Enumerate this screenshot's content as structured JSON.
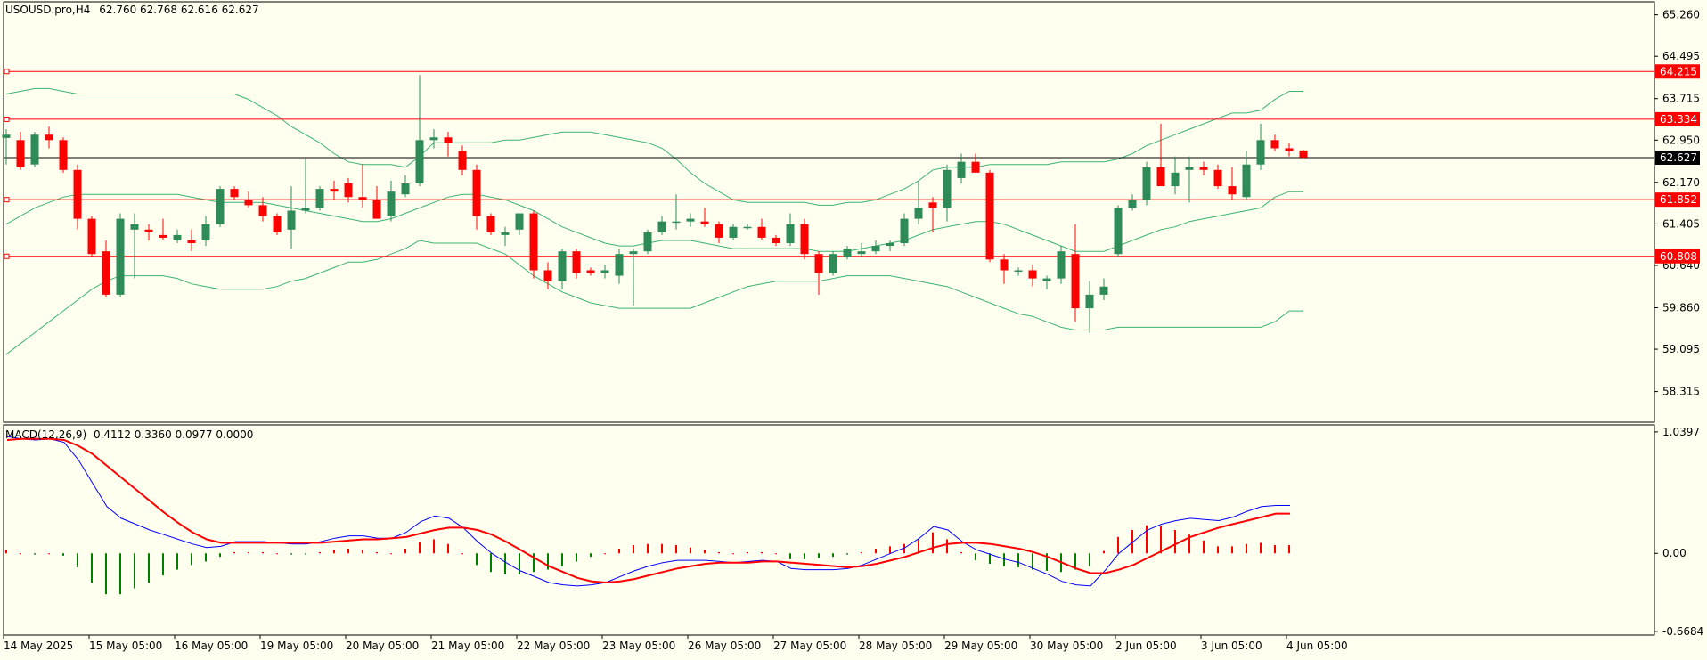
{
  "header": {
    "symbol": "USOUSD.pro,H4",
    "ohlc": "62.760 62.768 62.616 62.627"
  },
  "macd_header": {
    "title": "MACD(12,26,9)",
    "values": "0.4112 0.3360 0.0977 0.0000"
  },
  "colors": {
    "background": "#fffff0",
    "bull_candle": "#2e8b57",
    "bear_candle": "#ff0000",
    "bands": "#3cb371",
    "level_line": "#ff0000",
    "price_line": "#000000",
    "macd_line": "#0000ff",
    "signal_line": "#ff0000",
    "hist_positive": "#ff0000",
    "hist_negative": "#008000"
  },
  "chart_data": {
    "type": "candlestick",
    "symbol": "USOUSD.pro",
    "timeframe": "H4",
    "price_axis": {
      "ylim": [
        57.75,
        65.5
      ],
      "ticks": [
        "65.260",
        "64.495",
        "63.715",
        "62.950",
        "62.170",
        "61.405",
        "60.640",
        "59.860",
        "59.095",
        "58.315"
      ]
    },
    "time_axis": {
      "ticks": [
        {
          "label": "14 May 2025",
          "bar": 0
        },
        {
          "label": "15 May 05:00",
          "bar": 6
        },
        {
          "label": "16 May 05:00",
          "bar": 12
        },
        {
          "label": "19 May 05:00",
          "bar": 18
        },
        {
          "label": "20 May 05:00",
          "bar": 24
        },
        {
          "label": "21 May 05:00",
          "bar": 30
        },
        {
          "label": "22 May 05:00",
          "bar": 36
        },
        {
          "label": "23 May 05:00",
          "bar": 42
        },
        {
          "label": "26 May 05:00",
          "bar": 48
        },
        {
          "label": "27 May 05:00",
          "bar": 54
        },
        {
          "label": "28 May 05:00",
          "bar": 60
        },
        {
          "label": "29 May 05:00",
          "bar": 66
        },
        {
          "label": "30 May 05:00",
          "bar": 72
        },
        {
          "label": "2 Jun 05:00",
          "bar": 78
        },
        {
          "label": "3 Jun 05:00",
          "bar": 84
        },
        {
          "label": "4 Jun 05:00",
          "bar": 90
        }
      ]
    },
    "levels": [
      {
        "label": "64.215",
        "value": 64.215,
        "style": "red"
      },
      {
        "label": "63.334",
        "value": 63.334,
        "style": "red"
      },
      {
        "label": "62.627",
        "value": 62.627,
        "style": "current"
      },
      {
        "label": "61.852",
        "value": 61.852,
        "style": "red"
      },
      {
        "label": "60.808",
        "value": 60.808,
        "style": "red"
      }
    ],
    "candles": [
      {
        "o": 62.99,
        "h": 63.15,
        "l": 62.5,
        "c": 63.05
      },
      {
        "o": 62.95,
        "h": 63.1,
        "l": 62.4,
        "c": 62.45
      },
      {
        "o": 62.5,
        "h": 63.1,
        "l": 62.45,
        "c": 63.05
      },
      {
        "o": 63.05,
        "h": 63.2,
        "l": 62.8,
        "c": 62.95
      },
      {
        "o": 62.95,
        "h": 63.0,
        "l": 62.35,
        "c": 62.4
      },
      {
        "o": 62.4,
        "h": 62.5,
        "l": 61.3,
        "c": 61.5
      },
      {
        "o": 61.5,
        "h": 61.55,
        "l": 60.8,
        "c": 60.85
      },
      {
        "o": 60.9,
        "h": 61.1,
        "l": 60.05,
        "c": 60.1
      },
      {
        "o": 60.1,
        "h": 61.6,
        "l": 60.05,
        "c": 61.5
      },
      {
        "o": 61.3,
        "h": 61.6,
        "l": 60.4,
        "c": 61.4
      },
      {
        "o": 61.3,
        "h": 61.4,
        "l": 61.1,
        "c": 61.25
      },
      {
        "o": 61.2,
        "h": 61.5,
        "l": 61.1,
        "c": 61.15
      },
      {
        "o": 61.1,
        "h": 61.3,
        "l": 61.05,
        "c": 61.2
      },
      {
        "o": 61.1,
        "h": 61.3,
        "l": 60.9,
        "c": 61.05
      },
      {
        "o": 61.1,
        "h": 61.55,
        "l": 61.0,
        "c": 61.4
      },
      {
        "o": 61.4,
        "h": 62.1,
        "l": 61.35,
        "c": 62.05
      },
      {
        "o": 62.05,
        "h": 62.1,
        "l": 61.85,
        "c": 61.9
      },
      {
        "o": 61.85,
        "h": 62.0,
        "l": 61.7,
        "c": 61.75
      },
      {
        "o": 61.75,
        "h": 61.9,
        "l": 61.45,
        "c": 61.55
      },
      {
        "o": 61.55,
        "h": 61.6,
        "l": 61.2,
        "c": 61.25
      },
      {
        "o": 61.3,
        "h": 62.1,
        "l": 60.95,
        "c": 61.65
      },
      {
        "o": 61.65,
        "h": 62.6,
        "l": 61.6,
        "c": 61.7
      },
      {
        "o": 61.7,
        "h": 62.1,
        "l": 61.65,
        "c": 62.05
      },
      {
        "o": 62.05,
        "h": 62.2,
        "l": 61.85,
        "c": 62.0
      },
      {
        "o": 62.15,
        "h": 62.25,
        "l": 61.8,
        "c": 61.9
      },
      {
        "o": 61.9,
        "h": 62.5,
        "l": 61.7,
        "c": 61.85
      },
      {
        "o": 61.85,
        "h": 62.1,
        "l": 61.5,
        "c": 61.5
      },
      {
        "o": 61.55,
        "h": 62.2,
        "l": 61.45,
        "c": 62.0
      },
      {
        "o": 61.95,
        "h": 62.3,
        "l": 61.9,
        "c": 62.15
      },
      {
        "o": 62.15,
        "h": 64.15,
        "l": 62.1,
        "c": 62.95
      },
      {
        "o": 62.95,
        "h": 63.15,
        "l": 62.8,
        "c": 63.0
      },
      {
        "o": 63.0,
        "h": 63.1,
        "l": 62.65,
        "c": 62.9
      },
      {
        "o": 62.75,
        "h": 62.85,
        "l": 62.3,
        "c": 62.4
      },
      {
        "o": 62.4,
        "h": 62.5,
        "l": 61.3,
        "c": 61.55
      },
      {
        "o": 61.55,
        "h": 61.6,
        "l": 61.2,
        "c": 61.25
      },
      {
        "o": 61.2,
        "h": 61.35,
        "l": 61.0,
        "c": 61.25
      },
      {
        "o": 61.3,
        "h": 61.6,
        "l": 61.2,
        "c": 61.6
      },
      {
        "o": 61.6,
        "h": 61.65,
        "l": 60.4,
        "c": 60.55
      },
      {
        "o": 60.55,
        "h": 60.7,
        "l": 60.2,
        "c": 60.35
      },
      {
        "o": 60.35,
        "h": 60.95,
        "l": 60.2,
        "c": 60.9
      },
      {
        "o": 60.9,
        "h": 60.95,
        "l": 60.4,
        "c": 60.5
      },
      {
        "o": 60.55,
        "h": 60.6,
        "l": 60.45,
        "c": 60.5
      },
      {
        "o": 60.5,
        "h": 60.65,
        "l": 60.4,
        "c": 60.55
      },
      {
        "o": 60.45,
        "h": 60.95,
        "l": 60.3,
        "c": 60.85
      },
      {
        "o": 60.85,
        "h": 60.95,
        "l": 59.9,
        "c": 60.9
      },
      {
        "o": 60.9,
        "h": 61.3,
        "l": 60.85,
        "c": 61.25
      },
      {
        "o": 61.25,
        "h": 61.55,
        "l": 61.2,
        "c": 61.45
      },
      {
        "o": 61.45,
        "h": 61.95,
        "l": 61.3,
        "c": 61.45
      },
      {
        "o": 61.45,
        "h": 61.6,
        "l": 61.35,
        "c": 61.5
      },
      {
        "o": 61.45,
        "h": 61.7,
        "l": 61.35,
        "c": 61.4
      },
      {
        "o": 61.4,
        "h": 61.45,
        "l": 61.05,
        "c": 61.15
      },
      {
        "o": 61.15,
        "h": 61.4,
        "l": 61.1,
        "c": 61.35
      },
      {
        "o": 61.35,
        "h": 61.4,
        "l": 61.3,
        "c": 61.35
      },
      {
        "o": 61.35,
        "h": 61.5,
        "l": 61.1,
        "c": 61.15
      },
      {
        "o": 61.15,
        "h": 61.2,
        "l": 61.0,
        "c": 61.05
      },
      {
        "o": 61.05,
        "h": 61.6,
        "l": 61.0,
        "c": 61.4
      },
      {
        "o": 61.4,
        "h": 61.5,
        "l": 60.75,
        "c": 60.85
      },
      {
        "o": 60.85,
        "h": 60.9,
        "l": 60.1,
        "c": 60.5
      },
      {
        "o": 60.5,
        "h": 60.9,
        "l": 60.45,
        "c": 60.85
      },
      {
        "o": 60.8,
        "h": 61.0,
        "l": 60.75,
        "c": 60.95
      },
      {
        "o": 60.85,
        "h": 61.05,
        "l": 60.8,
        "c": 60.9
      },
      {
        "o": 60.9,
        "h": 61.1,
        "l": 60.85,
        "c": 61.0
      },
      {
        "o": 61.0,
        "h": 61.1,
        "l": 60.9,
        "c": 61.05
      },
      {
        "o": 61.05,
        "h": 61.6,
        "l": 61.0,
        "c": 61.5
      },
      {
        "o": 61.5,
        "h": 62.2,
        "l": 61.4,
        "c": 61.7
      },
      {
        "o": 61.8,
        "h": 61.9,
        "l": 61.25,
        "c": 61.7
      },
      {
        "o": 61.7,
        "h": 62.5,
        "l": 61.45,
        "c": 62.4
      },
      {
        "o": 62.25,
        "h": 62.7,
        "l": 62.15,
        "c": 62.55
      },
      {
        "o": 62.55,
        "h": 62.7,
        "l": 62.45,
        "c": 62.35
      },
      {
        "o": 62.35,
        "h": 62.4,
        "l": 60.7,
        "c": 60.75
      },
      {
        "o": 60.75,
        "h": 60.85,
        "l": 60.3,
        "c": 60.55
      },
      {
        "o": 60.55,
        "h": 60.6,
        "l": 60.45,
        "c": 60.55
      },
      {
        "o": 60.55,
        "h": 60.65,
        "l": 60.25,
        "c": 60.4
      },
      {
        "o": 60.35,
        "h": 60.45,
        "l": 60.2,
        "c": 60.4
      },
      {
        "o": 60.4,
        "h": 61.0,
        "l": 60.3,
        "c": 60.9
      },
      {
        "o": 60.85,
        "h": 61.4,
        "l": 59.6,
        "c": 59.85
      },
      {
        "o": 59.85,
        "h": 60.35,
        "l": 59.4,
        "c": 60.1
      },
      {
        "o": 60.1,
        "h": 60.4,
        "l": 60.0,
        "c": 60.25
      },
      {
        "o": 60.85,
        "h": 61.75,
        "l": 60.8,
        "c": 61.7
      },
      {
        "o": 61.7,
        "h": 61.95,
        "l": 61.65,
        "c": 61.85
      },
      {
        "o": 61.85,
        "h": 62.55,
        "l": 61.75,
        "c": 62.45
      },
      {
        "o": 62.45,
        "h": 63.25,
        "l": 62.3,
        "c": 62.1
      },
      {
        "o": 62.1,
        "h": 62.65,
        "l": 61.95,
        "c": 62.35
      },
      {
        "o": 62.4,
        "h": 62.65,
        "l": 61.8,
        "c": 62.45
      },
      {
        "o": 62.45,
        "h": 62.55,
        "l": 62.3,
        "c": 62.4
      },
      {
        "o": 62.4,
        "h": 62.5,
        "l": 62.05,
        "c": 62.1
      },
      {
        "o": 62.1,
        "h": 62.45,
        "l": 61.85,
        "c": 61.95
      },
      {
        "o": 61.9,
        "h": 62.75,
        "l": 61.85,
        "c": 62.5
      },
      {
        "o": 62.5,
        "h": 63.25,
        "l": 62.4,
        "c": 62.95
      },
      {
        "o": 62.95,
        "h": 63.05,
        "l": 62.75,
        "c": 62.8
      },
      {
        "o": 62.8,
        "h": 62.9,
        "l": 62.65,
        "c": 62.75
      },
      {
        "o": 62.76,
        "h": 62.77,
        "l": 62.62,
        "c": 62.63
      }
    ],
    "bollinger": {
      "upper": [
        63.8,
        63.85,
        63.9,
        63.9,
        63.85,
        63.8,
        63.8,
        63.8,
        63.8,
        63.8,
        63.8,
        63.8,
        63.8,
        63.8,
        63.8,
        63.8,
        63.8,
        63.7,
        63.55,
        63.4,
        63.2,
        63.05,
        62.9,
        62.7,
        62.55,
        62.5,
        62.5,
        62.5,
        62.45,
        62.65,
        62.9,
        62.9,
        62.9,
        62.9,
        62.9,
        62.95,
        62.95,
        63.0,
        63.05,
        63.1,
        63.1,
        63.1,
        63.05,
        63.0,
        62.95,
        62.9,
        62.8,
        62.6,
        62.35,
        62.15,
        62.0,
        61.85,
        61.8,
        61.8,
        61.8,
        61.8,
        61.8,
        61.75,
        61.75,
        61.8,
        61.8,
        61.85,
        61.95,
        62.05,
        62.2,
        62.4,
        62.45,
        62.45,
        62.45,
        62.5,
        62.5,
        62.5,
        62.5,
        62.5,
        62.55,
        62.55,
        62.55,
        62.55,
        62.6,
        62.7,
        62.85,
        62.95,
        63.05,
        63.15,
        63.25,
        63.35,
        63.45,
        63.45,
        63.5,
        63.7,
        63.85,
        63.85
      ],
      "middle": [
        61.4,
        61.55,
        61.7,
        61.8,
        61.9,
        61.95,
        61.95,
        61.95,
        61.95,
        61.95,
        61.95,
        61.95,
        61.95,
        61.9,
        61.85,
        61.8,
        61.8,
        61.8,
        61.8,
        61.75,
        61.7,
        61.65,
        61.6,
        61.55,
        61.5,
        61.45,
        61.45,
        61.5,
        61.6,
        61.7,
        61.8,
        61.9,
        61.95,
        61.95,
        61.9,
        61.85,
        61.75,
        61.65,
        61.5,
        61.35,
        61.25,
        61.15,
        61.05,
        61.0,
        61.0,
        61.05,
        61.1,
        61.1,
        61.1,
        61.05,
        61.0,
        60.95,
        60.95,
        60.95,
        60.95,
        60.95,
        60.95,
        60.9,
        60.9,
        60.9,
        60.95,
        61.0,
        61.05,
        61.1,
        61.2,
        61.3,
        61.35,
        61.4,
        61.45,
        61.45,
        61.4,
        61.3,
        61.2,
        61.1,
        61.0,
        60.9,
        60.9,
        60.9,
        61.0,
        61.1,
        61.2,
        61.3,
        61.35,
        61.45,
        61.5,
        61.55,
        61.6,
        61.65,
        61.7,
        61.9,
        62.0,
        62.0
      ],
      "lower": [
        59.0,
        59.2,
        59.4,
        59.6,
        59.8,
        60.0,
        60.2,
        60.35,
        60.45,
        60.45,
        60.45,
        60.45,
        60.4,
        60.3,
        60.25,
        60.2,
        60.2,
        60.2,
        60.2,
        60.25,
        60.35,
        60.4,
        60.5,
        60.6,
        60.7,
        60.7,
        60.75,
        60.85,
        60.95,
        61.1,
        61.05,
        61.05,
        61.05,
        61.05,
        60.95,
        60.85,
        60.65,
        60.45,
        60.3,
        60.15,
        60.05,
        59.95,
        59.9,
        59.85,
        59.85,
        59.85,
        59.85,
        59.85,
        59.85,
        59.95,
        60.05,
        60.15,
        60.25,
        60.3,
        60.35,
        60.35,
        60.35,
        60.35,
        60.4,
        60.45,
        60.45,
        60.45,
        60.45,
        60.4,
        60.35,
        60.3,
        60.25,
        60.15,
        60.05,
        59.95,
        59.85,
        59.75,
        59.7,
        59.6,
        59.5,
        59.45,
        59.45,
        59.45,
        59.5,
        59.5,
        59.5,
        59.5,
        59.5,
        59.5,
        59.5,
        59.5,
        59.5,
        59.5,
        59.5,
        59.6,
        59.8,
        59.8
      ]
    },
    "macd": {
      "ylim": [
        -0.7,
        1.1
      ],
      "ticks": [
        "1.0397",
        "0.00",
        "-0.6684"
      ],
      "bar_from": 75,
      "macd_line": [
        1.0,
        0.98,
        0.97,
        0.98,
        0.95,
        0.8,
        0.6,
        0.4,
        0.3,
        0.25,
        0.2,
        0.16,
        0.12,
        0.08,
        0.05,
        0.06,
        0.1,
        0.1,
        0.1,
        0.09,
        0.08,
        0.08,
        0.1,
        0.13,
        0.15,
        0.15,
        0.13,
        0.13,
        0.18,
        0.27,
        0.32,
        0.3,
        0.22,
        0.1,
        0.0,
        -0.08,
        -0.15,
        -0.2,
        -0.25,
        -0.27,
        -0.28,
        -0.27,
        -0.25,
        -0.2,
        -0.15,
        -0.11,
        -0.08,
        -0.06,
        -0.06,
        -0.06,
        -0.07,
        -0.08,
        -0.07,
        -0.06,
        -0.07,
        -0.13,
        -0.14,
        -0.14,
        -0.14,
        -0.13,
        -0.1,
        -0.05,
        0.0,
        0.05,
        0.13,
        0.23,
        0.2,
        0.1,
        0.03,
        -0.01,
        -0.05,
        -0.08,
        -0.13,
        -0.18,
        -0.24,
        -0.27,
        -0.28,
        -0.15,
        0.0,
        0.1,
        0.2,
        0.25,
        0.28,
        0.3,
        0.29,
        0.28,
        0.31,
        0.36,
        0.4,
        0.41,
        0.41
      ],
      "signal_line": [
        0.97,
        0.98,
        0.98,
        0.98,
        0.97,
        0.92,
        0.85,
        0.75,
        0.65,
        0.55,
        0.45,
        0.35,
        0.26,
        0.18,
        0.12,
        0.09,
        0.09,
        0.09,
        0.09,
        0.09,
        0.09,
        0.09,
        0.09,
        0.1,
        0.11,
        0.12,
        0.12,
        0.13,
        0.14,
        0.17,
        0.2,
        0.22,
        0.22,
        0.2,
        0.16,
        0.1,
        0.03,
        -0.04,
        -0.11,
        -0.16,
        -0.21,
        -0.24,
        -0.25,
        -0.24,
        -0.22,
        -0.19,
        -0.16,
        -0.13,
        -0.11,
        -0.09,
        -0.08,
        -0.08,
        -0.08,
        -0.07,
        -0.07,
        -0.08,
        -0.09,
        -0.1,
        -0.11,
        -0.12,
        -0.11,
        -0.09,
        -0.06,
        -0.03,
        0.01,
        0.05,
        0.08,
        0.09,
        0.09,
        0.08,
        0.06,
        0.04,
        0.01,
        -0.03,
        -0.08,
        -0.13,
        -0.17,
        -0.17,
        -0.14,
        -0.1,
        -0.04,
        0.02,
        0.08,
        0.14,
        0.18,
        0.22,
        0.25,
        0.28,
        0.31,
        0.34,
        0.34
      ],
      "histogram": [
        0.03,
        0.0,
        -0.01,
        0.0,
        -0.02,
        -0.12,
        -0.25,
        -0.35,
        -0.35,
        -0.3,
        -0.25,
        -0.19,
        -0.14,
        -0.1,
        -0.07,
        -0.03,
        0.01,
        0.01,
        0.01,
        0.0,
        -0.01,
        -0.01,
        0.01,
        0.03,
        0.04,
        0.03,
        0.01,
        0.0,
        0.04,
        0.1,
        0.12,
        0.08,
        0.0,
        -0.1,
        -0.16,
        -0.18,
        -0.18,
        -0.16,
        -0.14,
        -0.11,
        -0.07,
        -0.03,
        0.0,
        0.04,
        0.07,
        0.08,
        0.08,
        0.07,
        0.05,
        0.03,
        0.01,
        0.0,
        0.01,
        0.01,
        0.0,
        -0.05,
        -0.05,
        -0.04,
        -0.03,
        -0.01,
        0.01,
        0.04,
        0.06,
        0.08,
        0.12,
        0.18,
        0.12,
        0.01,
        -0.06,
        -0.09,
        -0.11,
        -0.12,
        -0.14,
        -0.15,
        -0.16,
        -0.14,
        -0.11,
        0.02,
        0.14,
        0.2,
        0.24,
        0.23,
        0.2,
        0.16,
        0.11,
        0.06,
        0.06,
        0.08,
        0.09,
        0.07,
        0.07
      ]
    }
  }
}
